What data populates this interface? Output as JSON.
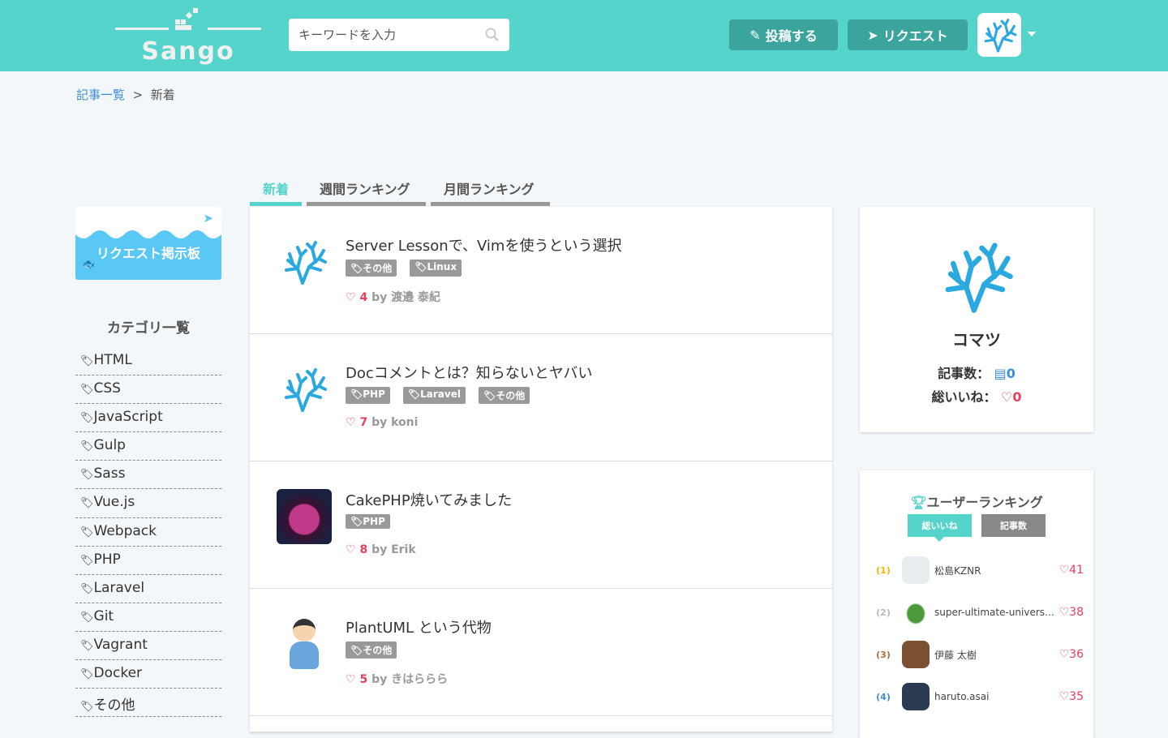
{
  "header": {
    "logo": "Sango",
    "search_placeholder": "キーワードを入力",
    "post_label": "投稿する",
    "request_label": "リクエスト"
  },
  "breadcrumb": {
    "parent": "記事一覧",
    "separator": ">",
    "current": "新着"
  },
  "tabs": [
    {
      "label": "新着"
    },
    {
      "label": "週間ランキング"
    },
    {
      "label": "月間ランキング"
    }
  ],
  "request_board": {
    "label": "リクエスト掲示板"
  },
  "categories": {
    "title": "カテゴリ一覧",
    "items": [
      "HTML",
      "CSS",
      "JavaScript",
      "Gulp",
      "Sass",
      "Vue.js",
      "Webpack",
      "PHP",
      "Laravel",
      "Git",
      "Vagrant",
      "Docker",
      "その他"
    ]
  },
  "articles": [
    {
      "title": "Server Lessonで、Vimを使うという選択",
      "tags": [
        "その他",
        "Linux"
      ],
      "likes": "4",
      "by": "by",
      "author": "渡邉 泰紀",
      "thumb": "coral"
    },
    {
      "title": "Docコメントとは？知らないとヤバい",
      "tags": [
        "PHP",
        "Laravel",
        "その他"
      ],
      "likes": "7",
      "by": "by",
      "author": "koni",
      "thumb": "coral"
    },
    {
      "title": "CakePHP焼いてみました",
      "tags": [
        "PHP"
      ],
      "likes": "8",
      "by": "by",
      "author": "Erik",
      "thumb": "photo"
    },
    {
      "title": "PlantUML という代物",
      "tags": [
        "その他"
      ],
      "likes": "5",
      "by": "by",
      "author": "きはららら",
      "thumb": "person"
    }
  ],
  "profile": {
    "name": "コマツ",
    "articles_label": "記事数：",
    "articles": "0",
    "likes_label": "総いいね：",
    "likes": "0"
  },
  "ranking": {
    "title": "ユーザーランキング",
    "tabs": [
      "総いいね",
      "記事数"
    ],
    "users": [
      {
        "rank": "1",
        "name": "松島KZNR",
        "likes": "41",
        "color": "#f5b800"
      },
      {
        "rank": "2",
        "name": "super-ultimate-universe-...",
        "likes": "38",
        "color": "#bbbbbb"
      },
      {
        "rank": "3",
        "name": "伊藤 太樹",
        "likes": "36",
        "color": "#b86b3d"
      },
      {
        "rank": "4",
        "name": "haruto.asai",
        "likes": "35",
        "color": "#3d8fd6"
      }
    ]
  },
  "colors": {
    "accent": "#55d4cb",
    "heart": "#e83d5d",
    "link": "#3d8fd6"
  }
}
